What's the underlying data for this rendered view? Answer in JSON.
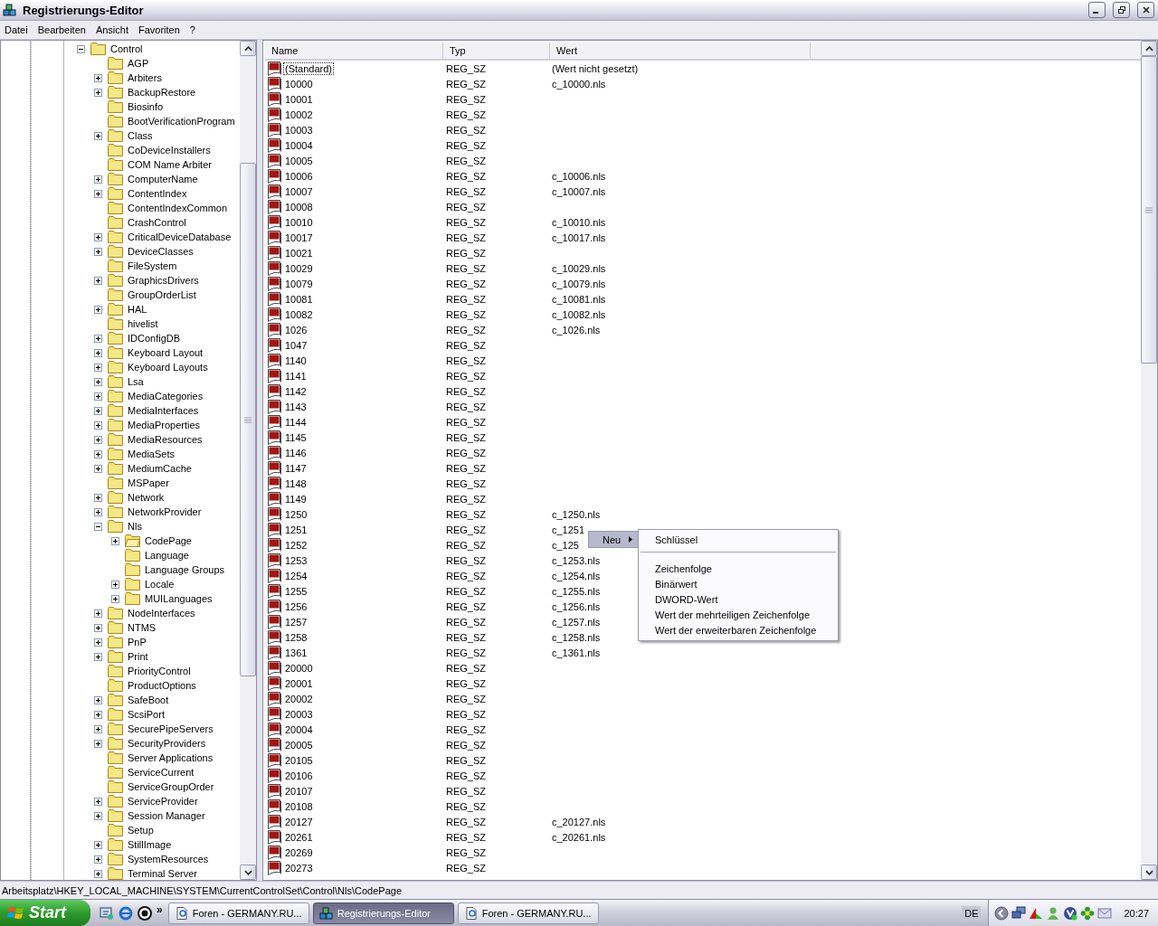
{
  "window": {
    "title": "Registrierungs-Editor"
  },
  "menu": [
    "Datei",
    "Bearbeiten",
    "Ansicht",
    "Favoriten",
    "?"
  ],
  "tree": {
    "items": [
      {
        "label": "Control",
        "expanded": true,
        "selected": false,
        "children": [
          {
            "label": "AGP",
            "selected": false
          },
          {
            "label": "Arbiters",
            "expanded": false,
            "selected": false
          },
          {
            "label": "BackupRestore",
            "expanded": false,
            "selected": false
          },
          {
            "label": "Biosinfo",
            "selected": false
          },
          {
            "label": "BootVerificationProgram",
            "selected": false
          },
          {
            "label": "Class",
            "expanded": false,
            "selected": false
          },
          {
            "label": "CoDeviceInstallers",
            "selected": false
          },
          {
            "label": "COM Name Arbiter",
            "selected": false
          },
          {
            "label": "ComputerName",
            "expanded": false,
            "selected": false
          },
          {
            "label": "ContentIndex",
            "expanded": false,
            "selected": false
          },
          {
            "label": "ContentIndexCommon",
            "selected": false
          },
          {
            "label": "CrashControl",
            "selected": false
          },
          {
            "label": "CriticalDeviceDatabase",
            "expanded": false,
            "selected": false
          },
          {
            "label": "DeviceClasses",
            "expanded": false,
            "selected": false
          },
          {
            "label": "FileSystem",
            "selected": false
          },
          {
            "label": "GraphicsDrivers",
            "expanded": false,
            "selected": false
          },
          {
            "label": "GroupOrderList",
            "selected": false
          },
          {
            "label": "HAL",
            "expanded": false,
            "selected": false
          },
          {
            "label": "hivelist",
            "selected": false
          },
          {
            "label": "IDConfigDB",
            "expanded": false,
            "selected": false
          },
          {
            "label": "Keyboard Layout",
            "expanded": false,
            "selected": false
          },
          {
            "label": "Keyboard Layouts",
            "expanded": false,
            "selected": false
          },
          {
            "label": "Lsa",
            "expanded": false,
            "selected": false
          },
          {
            "label": "MediaCategories",
            "expanded": false,
            "selected": false
          },
          {
            "label": "MediaInterfaces",
            "expanded": false,
            "selected": false
          },
          {
            "label": "MediaProperties",
            "expanded": false,
            "selected": false
          },
          {
            "label": "MediaResources",
            "expanded": false,
            "selected": false
          },
          {
            "label": "MediaSets",
            "expanded": false,
            "selected": false
          },
          {
            "label": "MediumCache",
            "expanded": false,
            "selected": false
          },
          {
            "label": "MSPaper",
            "selected": false
          },
          {
            "label": "Network",
            "expanded": false,
            "selected": false
          },
          {
            "label": "NetworkProvider",
            "expanded": false,
            "selected": false
          },
          {
            "label": "Nls",
            "expanded": true,
            "selected": false,
            "children": [
              {
                "label": "CodePage",
                "expanded": false,
                "selected": true
              },
              {
                "label": "Language",
                "selected": false
              },
              {
                "label": "Language Groups",
                "selected": false
              },
              {
                "label": "Locale",
                "expanded": false,
                "selected": false
              },
              {
                "label": "MUILanguages",
                "expanded": false,
                "selected": false
              }
            ]
          },
          {
            "label": "NodeInterfaces",
            "expanded": false,
            "selected": false
          },
          {
            "label": "NTMS",
            "expanded": false,
            "selected": false
          },
          {
            "label": "PnP",
            "expanded": false,
            "selected": false
          },
          {
            "label": "Print",
            "expanded": false,
            "selected": false
          },
          {
            "label": "PriorityControl",
            "selected": false
          },
          {
            "label": "ProductOptions",
            "selected": false
          },
          {
            "label": "SafeBoot",
            "expanded": false,
            "selected": false
          },
          {
            "label": "ScsiPort",
            "expanded": false,
            "selected": false
          },
          {
            "label": "SecurePipeServers",
            "expanded": false,
            "selected": false
          },
          {
            "label": "SecurityProviders",
            "expanded": false,
            "selected": false
          },
          {
            "label": "Server Applications",
            "selected": false
          },
          {
            "label": "ServiceCurrent",
            "selected": false
          },
          {
            "label": "ServiceGroupOrder",
            "selected": false
          },
          {
            "label": "ServiceProvider",
            "expanded": false,
            "selected": false
          },
          {
            "label": "Session Manager",
            "expanded": false,
            "selected": false
          },
          {
            "label": "Setup",
            "selected": false
          },
          {
            "label": "StillImage",
            "expanded": false,
            "selected": false
          },
          {
            "label": "SystemResources",
            "expanded": false,
            "selected": false
          },
          {
            "label": "Terminal Server",
            "expanded": false,
            "selected": false
          }
        ]
      }
    ]
  },
  "table": {
    "columns": [
      "Name",
      "Typ",
      "Wert"
    ],
    "rows": [
      {
        "name": "(Standard)",
        "type": "REG_SZ",
        "value": "(Wert nicht gesetzt)",
        "focused": true
      },
      {
        "name": "10000",
        "type": "REG_SZ",
        "value": "c_10000.nls",
        "focused": false
      },
      {
        "name": "10001",
        "type": "REG_SZ",
        "focused": false
      },
      {
        "name": "10002",
        "type": "REG_SZ",
        "focused": false
      },
      {
        "name": "10003",
        "type": "REG_SZ",
        "focused": false
      },
      {
        "name": "10004",
        "type": "REG_SZ",
        "focused": false
      },
      {
        "name": "10005",
        "type": "REG_SZ",
        "focused": false
      },
      {
        "name": "10006",
        "type": "REG_SZ",
        "value": "c_10006.nls",
        "focused": false
      },
      {
        "name": "10007",
        "type": "REG_SZ",
        "value": "c_10007.nls",
        "focused": false
      },
      {
        "name": "10008",
        "type": "REG_SZ",
        "focused": false
      },
      {
        "name": "10010",
        "type": "REG_SZ",
        "value": "c_10010.nls",
        "focused": false
      },
      {
        "name": "10017",
        "type": "REG_SZ",
        "value": "c_10017.nls",
        "focused": false
      },
      {
        "name": "10021",
        "type": "REG_SZ",
        "focused": false
      },
      {
        "name": "10029",
        "type": "REG_SZ",
        "value": "c_10029.nls",
        "focused": false
      },
      {
        "name": "10079",
        "type": "REG_SZ",
        "value": "c_10079.nls",
        "focused": false
      },
      {
        "name": "10081",
        "type": "REG_SZ",
        "value": "c_10081.nls",
        "focused": false
      },
      {
        "name": "10082",
        "type": "REG_SZ",
        "value": "c_10082.nls",
        "focused": false
      },
      {
        "name": "1026",
        "type": "REG_SZ",
        "value": "c_1026.nls",
        "focused": false
      },
      {
        "name": "1047",
        "type": "REG_SZ",
        "focused": false
      },
      {
        "name": "1140",
        "type": "REG_SZ",
        "focused": false
      },
      {
        "name": "1141",
        "type": "REG_SZ",
        "focused": false
      },
      {
        "name": "1142",
        "type": "REG_SZ",
        "focused": false
      },
      {
        "name": "1143",
        "type": "REG_SZ",
        "focused": false
      },
      {
        "name": "1144",
        "type": "REG_SZ",
        "focused": false
      },
      {
        "name": "1145",
        "type": "REG_SZ",
        "focused": false
      },
      {
        "name": "1146",
        "type": "REG_SZ",
        "focused": false
      },
      {
        "name": "1147",
        "type": "REG_SZ",
        "focused": false
      },
      {
        "name": "1148",
        "type": "REG_SZ",
        "focused": false
      },
      {
        "name": "1149",
        "type": "REG_SZ",
        "focused": false
      },
      {
        "name": "1250",
        "type": "REG_SZ",
        "value": "c_1250.nls",
        "focused": false
      },
      {
        "name": "1251",
        "type": "REG_SZ",
        "value": "c_1251",
        "focused": false
      },
      {
        "name": "1252",
        "type": "REG_SZ",
        "value": "c_125",
        "focused": false
      },
      {
        "name": "1253",
        "type": "REG_SZ",
        "value": "c_1253.nls",
        "focused": false
      },
      {
        "name": "1254",
        "type": "REG_SZ",
        "value": "c_1254.nls",
        "focused": false
      },
      {
        "name": "1255",
        "type": "REG_SZ",
        "value": "c_1255.nls",
        "focused": false
      },
      {
        "name": "1256",
        "type": "REG_SZ",
        "value": "c_1256.nls",
        "focused": false
      },
      {
        "name": "1257",
        "type": "REG_SZ",
        "value": "c_1257.nls",
        "focused": false
      },
      {
        "name": "1258",
        "type": "REG_SZ",
        "value": "c_1258.nls",
        "focused": false
      },
      {
        "name": "1361",
        "type": "REG_SZ",
        "value": "c_1361.nls",
        "focused": false
      },
      {
        "name": "20000",
        "type": "REG_SZ",
        "focused": false
      },
      {
        "name": "20001",
        "type": "REG_SZ",
        "focused": false
      },
      {
        "name": "20002",
        "type": "REG_SZ",
        "focused": false
      },
      {
        "name": "20003",
        "type": "REG_SZ",
        "focused": false
      },
      {
        "name": "20004",
        "type": "REG_SZ",
        "focused": false
      },
      {
        "name": "20005",
        "type": "REG_SZ",
        "focused": false
      },
      {
        "name": "20105",
        "type": "REG_SZ",
        "focused": false
      },
      {
        "name": "20106",
        "type": "REG_SZ",
        "focused": false
      },
      {
        "name": "20107",
        "type": "REG_SZ",
        "focused": false
      },
      {
        "name": "20108",
        "type": "REG_SZ",
        "focused": false
      },
      {
        "name": "20127",
        "type": "REG_SZ",
        "value": "c_20127.nls",
        "focused": false
      },
      {
        "name": "20261",
        "type": "REG_SZ",
        "value": "c_20261.nls",
        "focused": false
      },
      {
        "name": "20269",
        "type": "REG_SZ",
        "focused": false
      },
      {
        "name": "20273",
        "type": "REG_SZ",
        "focused": false
      }
    ]
  },
  "context_menu": {
    "items": [
      {
        "label": "Neu",
        "selected": true
      }
    ]
  },
  "submenu": {
    "items": [
      {
        "kind": "item",
        "label": "Schlüssel"
      },
      {
        "kind": "separator"
      },
      {
        "kind": "item",
        "label": "Zeichenfolge"
      },
      {
        "kind": "item",
        "label": "Binärwert"
      },
      {
        "kind": "item",
        "label": "DWORD-Wert"
      },
      {
        "kind": "item",
        "label": "Wert der mehrteiligen Zeichenfolge"
      },
      {
        "kind": "item",
        "label": "Wert der erweiterbaren Zeichenfolge"
      }
    ]
  },
  "status_bar": {
    "path": "Arbeitsplatz\\HKEY_LOCAL_MACHINE\\SYSTEM\\CurrentControlSet\\Control\\Nls\\CodePage"
  },
  "taskbar": {
    "start": "Start",
    "chevron": "»",
    "tasks": [
      {
        "label": "Foren - GERMANY.RU...",
        "kind": "browser",
        "selected": false
      },
      {
        "label": "Registrierungs-Editor",
        "kind": "registry",
        "selected": true
      },
      {
        "label": "Foren - GERMANY.RU...",
        "kind": "browser",
        "selected": false
      }
    ],
    "language": "DE",
    "clock": "20:27"
  }
}
